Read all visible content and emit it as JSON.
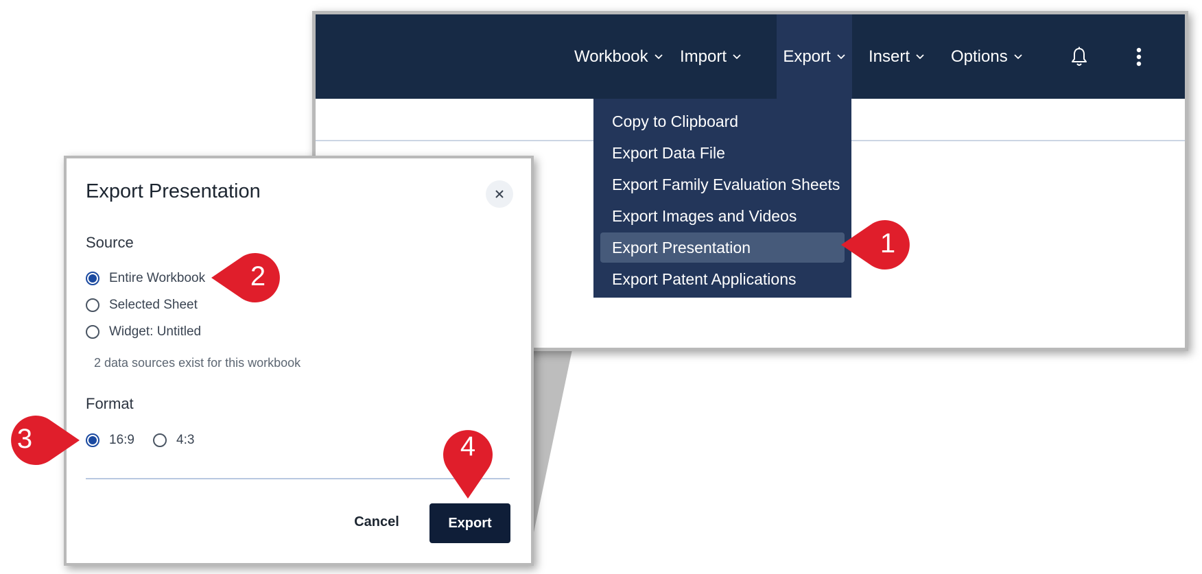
{
  "nav": {
    "workbook": "Workbook",
    "import": "Import",
    "export": "Export",
    "insert": "Insert",
    "options": "Options"
  },
  "export_menu": {
    "items": [
      {
        "label": "Copy to Clipboard"
      },
      {
        "label": "Export Data File"
      },
      {
        "label": "Export Family Evaluation Sheets"
      },
      {
        "label": "Export Images and Videos"
      },
      {
        "label": "Export Presentation",
        "highlighted": true
      },
      {
        "label": "Export Patent Applications"
      }
    ]
  },
  "dialog": {
    "title": "Export Presentation",
    "source_label": "Source",
    "source_options": [
      {
        "label": "Entire Workbook",
        "checked": true
      },
      {
        "label": "Selected Sheet",
        "checked": false
      },
      {
        "label": "Widget: Untitled",
        "checked": false
      }
    ],
    "hint": "2 data sources exist for this workbook",
    "format_label": "Format",
    "format_options": [
      {
        "label": "16:9",
        "checked": true
      },
      {
        "label": "4:3",
        "checked": false
      }
    ],
    "cancel_label": "Cancel",
    "export_label": "Export"
  },
  "callouts": [
    "1",
    "2",
    "3",
    "4"
  ],
  "colors": {
    "topbar": "#172a45",
    "menu": "#23365a",
    "menu_highlight": "#465a7a",
    "callout": "#e01e2b",
    "primary_button": "#0f1e38",
    "radio_checked": "#1b4aa0"
  },
  "icons": [
    "chevron-down-icon",
    "bell-icon",
    "more-vertical-icon",
    "close-icon"
  ]
}
